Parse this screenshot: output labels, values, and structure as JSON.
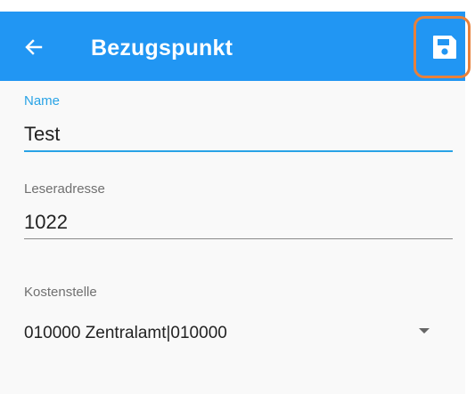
{
  "appbar": {
    "title": "Bezugspunkt",
    "back_icon": "arrow-left-icon",
    "save_icon": "floppy-disk-icon",
    "color": "#2196f3",
    "highlight_color": "#e8803a"
  },
  "fields": {
    "name": {
      "label": "Name",
      "value": "Test",
      "accent": "#29a3e6"
    },
    "leseradresse": {
      "label": "Leseradresse",
      "value": "1022"
    },
    "kostenstelle": {
      "label": "Kostenstelle",
      "value": "010000 Zentralamt|010000"
    }
  }
}
